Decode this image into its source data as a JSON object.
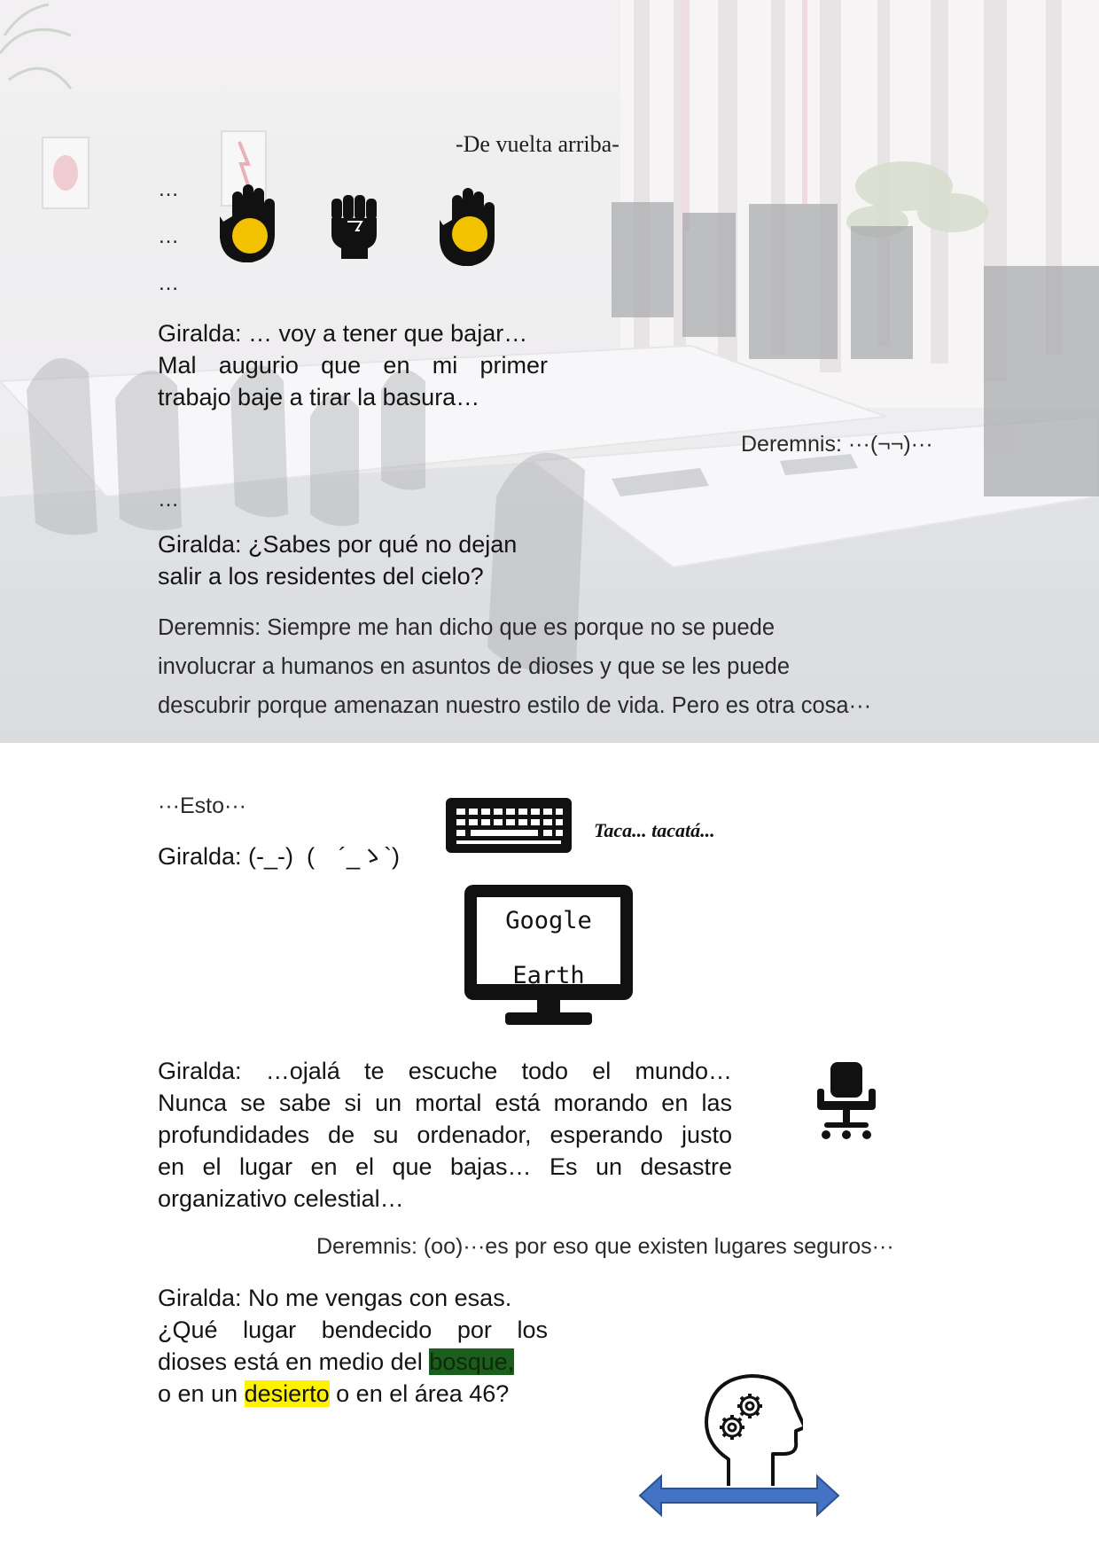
{
  "page": {
    "title": "-De vuelta arriba-",
    "ellipsis_lines": [
      "…",
      "…",
      "…"
    ],
    "icons_top": [
      "raised-hand-icon",
      "raised-fist-icon",
      "raised-hand-icon"
    ],
    "giralda_1": {
      "line1": "Giralda: … voy a tener que bajar…",
      "line2": "Mal augurio que en mi primer",
      "line3": "trabajo baje a tirar la basura…"
    },
    "deremnis_1": "Deremnis: ···(¬¬)···",
    "ellipsis_mid": "…",
    "giralda_2": {
      "line1": "Giralda: ¿Sabes por qué no dejan",
      "line2": "salir a los residentes del cielo?"
    },
    "deremnis_2": {
      "line1": "Deremnis: Siempre me han dicho que es porque no se puede",
      "line2": "involucrar a humanos en asuntos de dioses y que se les puede",
      "line3": "descubrir porque amenazan nuestro estilo de vida. Pero es otra cosa···"
    },
    "esto": "···Esto···",
    "giralda_3": "Giralda: (-_-)  (　´_ゝ`)",
    "typing_sound": "Taca... tacatá...",
    "monitor": {
      "line1": "Google",
      "line2": "Earth"
    },
    "giralda_4": {
      "line1": "Giralda: …ojalá te escuche todo el mundo…",
      "line2": "Nunca se sabe si un mortal está morando en las",
      "line3": "profundidades de su ordenador, esperando justo",
      "line4": "en el lugar en el que bajas… Es un desastre",
      "line5": "organizativo celestial…"
    },
    "deremnis_3": "Deremnis: (oo)···es por eso que existen lugares seguros···",
    "giralda_5": {
      "line1": "Giralda: No me vengas con esas.",
      "line2": "¿Qué lugar bendecido por los",
      "line3_pre": "dioses está en medio del ",
      "line3_hl": "bosque,",
      "line4_pre": "o en un ",
      "line4_hl": "desierto",
      "line4_post": " o en el área 46?"
    },
    "icons_bottom": [
      "keyboard-icon",
      "monitor-icon",
      "office-chair-icon",
      "head-gears-icon",
      "double-arrow-icon"
    ],
    "colors": {
      "hand_dot": "#f2c200",
      "highlight_green": "#1c5e1c",
      "highlight_yellow": "#fff200",
      "arrow_blue": "#4472c4"
    }
  }
}
